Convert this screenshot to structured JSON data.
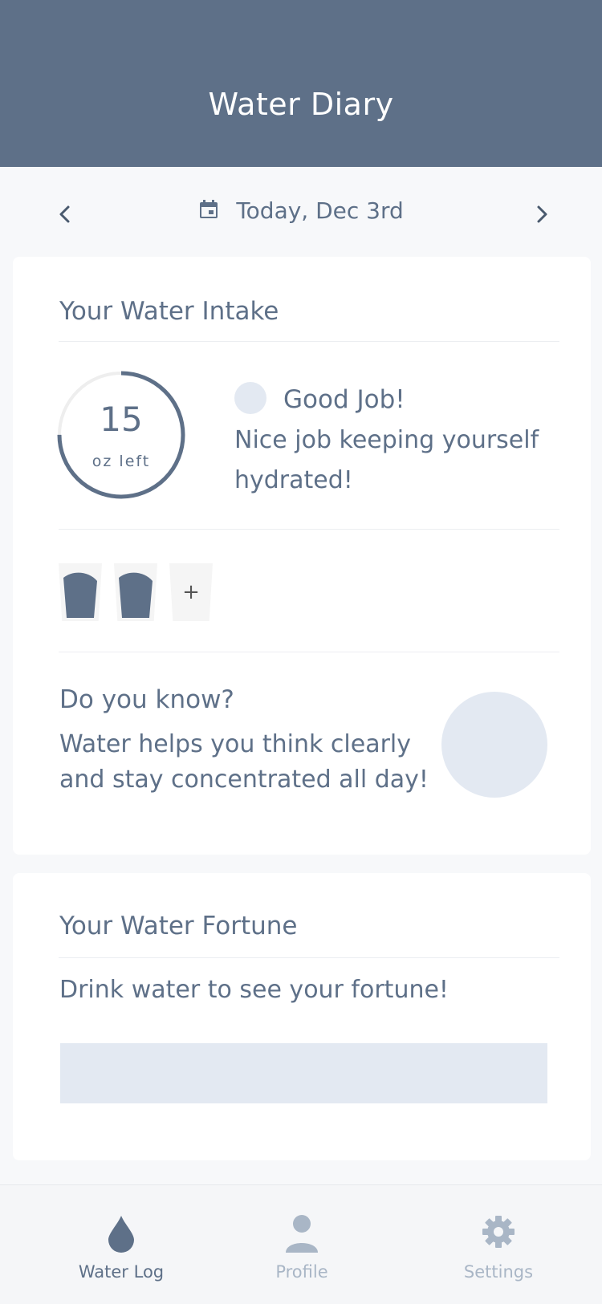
{
  "header": {
    "title": "Water Diary"
  },
  "date_nav": {
    "label": "Today, Dec 3rd",
    "prev_icon": "chevron-left-icon",
    "next_icon": "chevron-right-icon",
    "calendar_icon": "calendar-icon"
  },
  "intake_card": {
    "title": "Your Water Intake",
    "remaining_value": "15",
    "remaining_unit": "oz left",
    "progress_fraction": 0.75,
    "message_title": "Good Job!",
    "message_text": "Nice job keeping yourself hydrated!",
    "cups": [
      {
        "filled": true
      },
      {
        "filled": true
      }
    ],
    "add_cup_label": "+",
    "tip_title": "Do you know?",
    "tip_text": "Water helps you think clearly and stay concentrated all day!"
  },
  "fortune_card": {
    "title": "Your Water Fortune",
    "text": "Drink water to see your fortune!"
  },
  "tabbar": {
    "tabs": [
      {
        "label": "Water Log",
        "icon": "water-drop-icon",
        "active": true
      },
      {
        "label": "Profile",
        "icon": "person-icon",
        "active": false
      },
      {
        "label": "Settings",
        "icon": "gear-icon",
        "active": false
      }
    ]
  },
  "colors": {
    "primary": "#5e7088",
    "accent_light": "#e3e9f2",
    "inactive": "#a9b6c6"
  }
}
